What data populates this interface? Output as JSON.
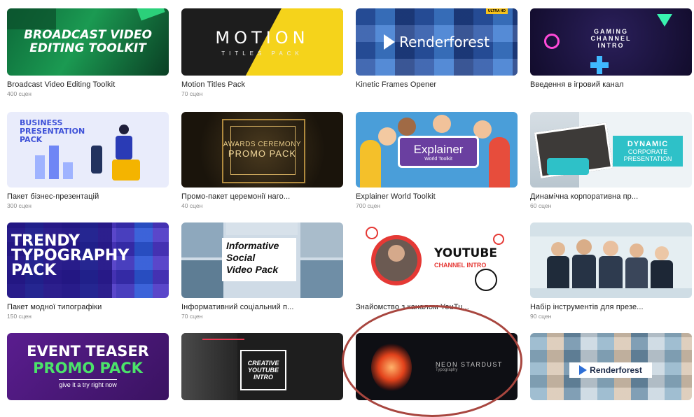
{
  "cards": [
    {
      "title": "Broadcast Video Editing Toolkit",
      "count": "400 сцен",
      "thumb_text": [
        "BROADCAST VIDEO",
        "EDITING TOOLKIT"
      ]
    },
    {
      "title": "Motion Titles Pack",
      "count": "70 сцен",
      "thumb_text": [
        "MOTION",
        "TITLES PACK"
      ]
    },
    {
      "title": "Kinetic Frames Opener",
      "count": "",
      "thumb_text": [
        "Renderforest",
        "ULTRA HD"
      ]
    },
    {
      "title": "Введення в ігровий канал",
      "count": "",
      "thumb_text": [
        "GAMING",
        "CHANNEL",
        "INTRO"
      ]
    },
    {
      "title": "Пакет бізнес-презентацій",
      "count": "300 сцен",
      "thumb_text": [
        "BUSINESS",
        "PRESENTATION",
        "PACK"
      ]
    },
    {
      "title": "Промо-пакет церемонії наго...",
      "count": "40 сцен",
      "thumb_text": [
        "AWARDS CEREMONY",
        "PROMO PACK"
      ]
    },
    {
      "title": "Explainer World Toolkit",
      "count": "700 сцен",
      "thumb_text": [
        "Explainer",
        "World Toolkit"
      ]
    },
    {
      "title": "Динамічна корпоративна пр...",
      "count": "60 сцен",
      "thumb_text": [
        "DYNAMIC",
        "CORPORATE",
        "PRESENTATION"
      ]
    },
    {
      "title": "Пакет модної типографіки",
      "count": "150 сцен",
      "thumb_text": [
        "TRENDY",
        "TYPOGRAPHY",
        "PACK"
      ]
    },
    {
      "title": "Інформативний соціальний п...",
      "count": "70 сцен",
      "thumb_text": [
        "Informative",
        "Social",
        "Video Pack"
      ]
    },
    {
      "title": "Знайомство з каналом YouTu...",
      "count": "",
      "thumb_text": [
        "YOUTUBE",
        "CHANNEL INTRO"
      ]
    },
    {
      "title": "Набір інструментів для презе...",
      "count": "90 сцен",
      "thumb_text": []
    },
    {
      "title": "",
      "count": "",
      "thumb_text": [
        "EVENT TEASER",
        "PROMO PACK",
        "give it a try right now"
      ]
    },
    {
      "title": "",
      "count": "",
      "thumb_text": [
        "CREATIVE",
        "YOUTUBE",
        "INTRO"
      ]
    },
    {
      "title": "",
      "count": "",
      "thumb_text": [
        "NEON STARDUST",
        "Typography"
      ]
    },
    {
      "title": "",
      "count": "",
      "thumb_text": [
        "Renderforest"
      ]
    }
  ],
  "colors": {
    "annotation": "#a8463f",
    "motion_yellow": "#f5d31b",
    "gaming_bg": "#1a1440",
    "business_bg": "#e9ecfb"
  }
}
